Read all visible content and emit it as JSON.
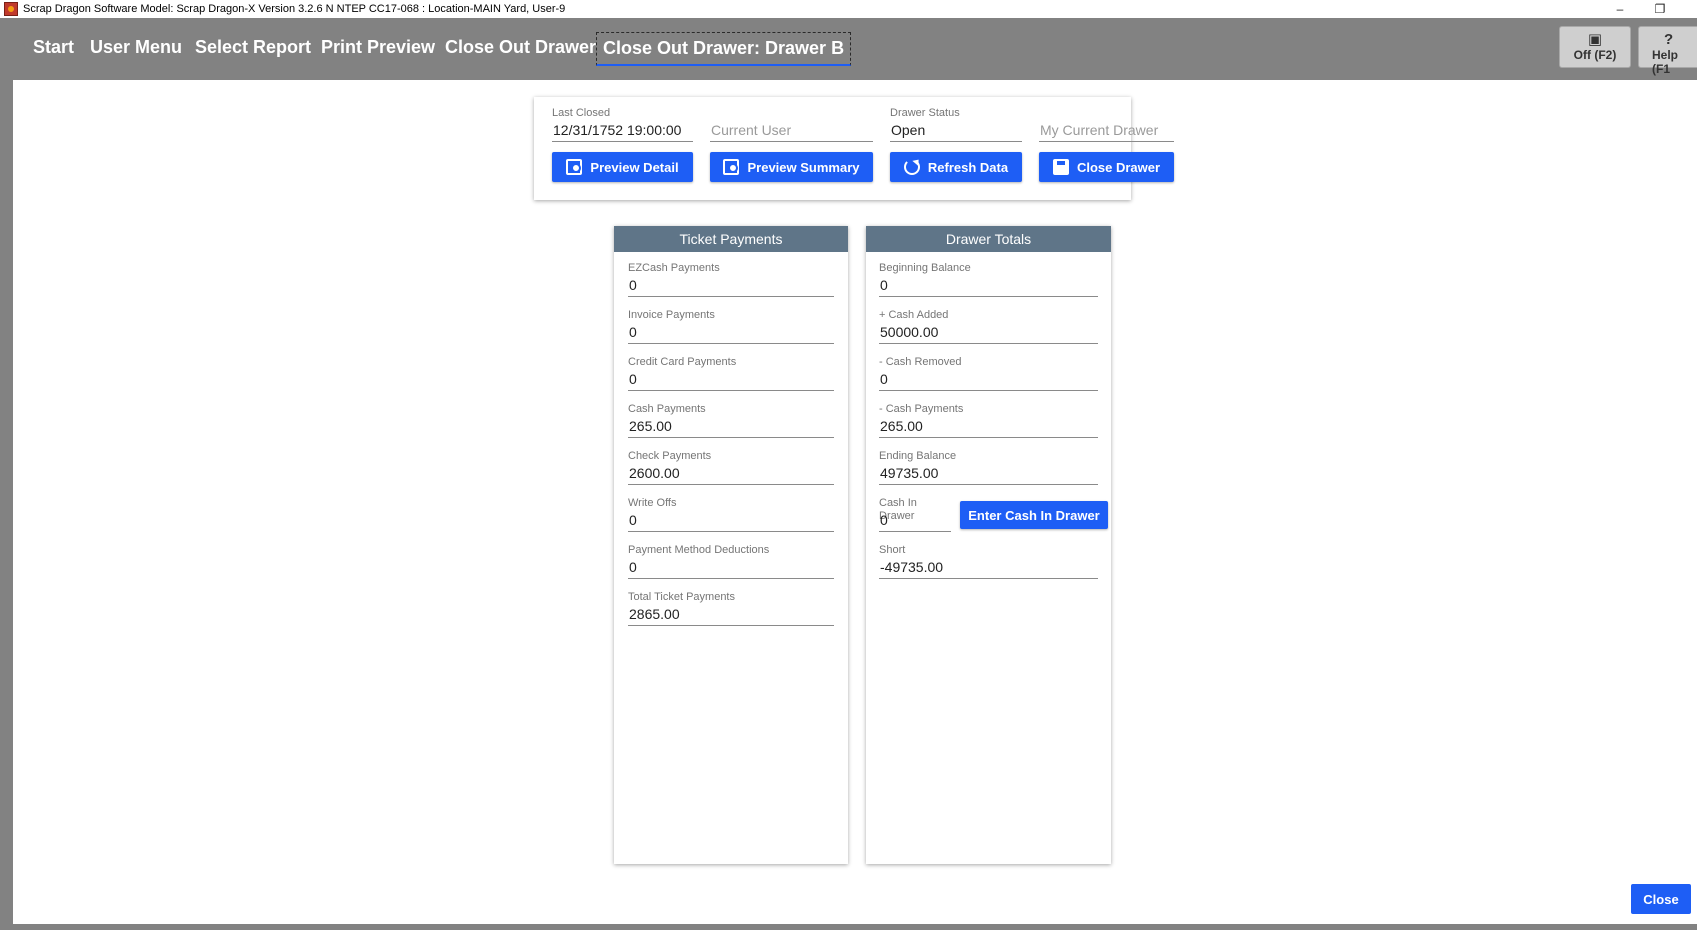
{
  "window": {
    "title": "Scrap Dragon Software Model: Scrap Dragon-X Version 3.2.6 N NTEP CC17-068 : Location-MAIN Yard, User-9",
    "minimize_glyph": "–",
    "restore_glyph": "❐"
  },
  "nav": {
    "start": "Start",
    "user_menu": "User Menu",
    "select_report": "Select Report",
    "print_preview": "Print Preview",
    "close_out_drawer": "Close Out Drawer",
    "active": "Close Out Drawer: Drawer B"
  },
  "toolbar": {
    "off_label": "Off (F2)",
    "help_label": "Help (F1"
  },
  "header": {
    "last_closed": {
      "label": "Last Closed",
      "value": "12/31/1752 19:00:00"
    },
    "current_user": {
      "placeholder": "Current User"
    },
    "drawer_status": {
      "label": "Drawer Status",
      "value": "Open"
    },
    "my_current_drawer": {
      "placeholder": "My Current Drawer"
    },
    "buttons": {
      "preview_detail": "Preview Detail",
      "preview_summary": "Preview Summary",
      "refresh_data": "Refresh Data",
      "close_drawer": "Close Drawer"
    }
  },
  "ticket_payments": {
    "title": "Ticket Payments",
    "fields": [
      {
        "label": "EZCash Payments",
        "value": "0"
      },
      {
        "label": "Invoice Payments",
        "value": "0"
      },
      {
        "label": "Credit Card Payments",
        "value": "0"
      },
      {
        "label": "Cash Payments",
        "value": "265.00"
      },
      {
        "label": "Check Payments",
        "value": "2600.00"
      },
      {
        "label": "Write Offs",
        "value": "0"
      },
      {
        "label": "Payment Method Deductions",
        "value": "0"
      },
      {
        "label": "Total Ticket Payments",
        "value": "2865.00"
      }
    ]
  },
  "drawer_totals": {
    "title": "Drawer Totals",
    "fields": [
      {
        "label": "Beginning Balance",
        "value": "0"
      },
      {
        "label": "+ Cash Added",
        "value": "50000.00"
      },
      {
        "label": "- Cash Removed",
        "value": "0"
      },
      {
        "label": "- Cash Payments",
        "value": "265.00"
      },
      {
        "label": "Ending Balance",
        "value": "49735.00"
      },
      {
        "label": "Cash In Drawer",
        "value": "0"
      },
      {
        "label": "Short",
        "value": "-49735.00"
      }
    ],
    "enter_cash_button": "Enter Cash In Drawer"
  },
  "footer": {
    "close_button": "Close"
  }
}
